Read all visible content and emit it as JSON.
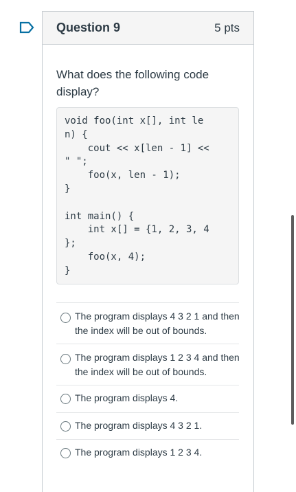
{
  "question": {
    "title": "Question 9",
    "points": "5 pts",
    "prompt": "What does the following code display?",
    "code": "void foo(int x[], int le\nn) {\n    cout << x[len - 1] <<\n\" \";\n    foo(x, len - 1);\n}\n\nint main() {\n    int x[] = {1, 2, 3, 4\n};\n    foo(x, 4);\n}"
  },
  "answers": [
    {
      "text": "The program displays 4 3 2 1 and then the index will be out of bounds."
    },
    {
      "text": "The program displays 1 2 3 4 and then the index will be out of bounds."
    },
    {
      "text": "The program displays 4."
    },
    {
      "text": "The program displays 4 3 2 1."
    },
    {
      "text": "The program displays 1 2 3 4."
    }
  ],
  "colors": {
    "text": "#2d3b45",
    "header_bg": "#f5f5f5",
    "border": "#c7cdd1",
    "flag": "#0770a3"
  }
}
